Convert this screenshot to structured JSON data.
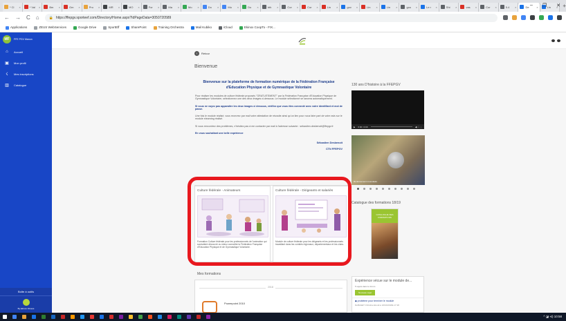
{
  "browser": {
    "tabs": [
      {
        "label": "* Cl",
        "color": "#e8a33d"
      },
      {
        "label": "* Val",
        "color": "#d93025"
      },
      {
        "label": "Bm",
        "color": "#d93025"
      },
      {
        "label": "Gm",
        "color": "#d93025"
      },
      {
        "label": "Pro",
        "color": "#e8a33d"
      },
      {
        "label": "MR",
        "color": "#3c4043"
      },
      {
        "label": "MO",
        "color": "#3c4043"
      },
      {
        "label": "For",
        "color": "#5f6368"
      },
      {
        "label": "Ma",
        "color": "#5f6368"
      },
      {
        "label": "Mo",
        "color": "#34a853"
      },
      {
        "label": "Do",
        "color": "#4285f4"
      },
      {
        "label": "Mo",
        "color": "#4285f4"
      },
      {
        "label": "Do",
        "color": "#34a853"
      },
      {
        "label": "bth",
        "color": "#5f6368"
      },
      {
        "label": "Cor",
        "color": "#5f6368"
      },
      {
        "label": "Cor",
        "color": "#d93025"
      },
      {
        "label": "Lin",
        "color": "#d93025"
      },
      {
        "label": "gov",
        "color": "#1a73e8"
      },
      {
        "label": "Lin",
        "color": "#d93025"
      },
      {
        "label": "Lin",
        "color": "#1a73e8"
      },
      {
        "label": "goo",
        "color": "#5f6368"
      },
      {
        "label": "Le r",
        "color": "#1a73e8"
      },
      {
        "label": "Shi",
        "color": "#5f6368"
      },
      {
        "label": "vas",
        "color": "#d93025"
      },
      {
        "label": "Cor",
        "color": "#5f6368"
      },
      {
        "label": "5.4",
        "color": "#5f6368"
      },
      {
        "label": "De",
        "color": "#1a73e8",
        "active": true
      },
      {
        "label": "Lin",
        "color": "#1a73e8"
      }
    ],
    "new_tab": "+",
    "window_controls": [
      "–",
      "❐",
      "✕"
    ],
    "back": "←",
    "forward": "→",
    "reload": "C",
    "home": "⌂",
    "url": "https://ffepgv.sporteef.com/Directory/Home.aspx?IdPageData=3050720589",
    "bookmarks": [
      {
        "label": "Applications",
        "color": "#4285f4"
      },
      {
        "label": "ZEUS WebServices",
        "color": "#9aa0a6"
      },
      {
        "label": "Google Drive",
        "color": "#34a853"
      },
      {
        "label": "SportEff",
        "color": "#9aa0a6"
      },
      {
        "label": "SharePoint",
        "color": "#1a73e8"
      },
      {
        "label": "Training Orchestra",
        "color": "#e8a33d"
      },
      {
        "label": "Mail Kubiko",
        "color": "#1a73e8"
      },
      {
        "label": "iCloud",
        "color": "#5f6368"
      },
      {
        "label": "Ekinox CoopTo - FIX...",
        "color": "#34a853"
      }
    ],
    "ext_colors": [
      "#5f6368",
      "#e8a33d",
      "#4285f4",
      "#3c4043",
      "#34a853",
      "#1a73e8",
      "#3c4043"
    ]
  },
  "sidebar": {
    "avatar_initials": "MF",
    "org_name": "FFE PGV Manon",
    "items": [
      {
        "icon": "⌂",
        "label": "Accueil"
      },
      {
        "icon": "▣",
        "label": "Mon profil"
      },
      {
        "icon": "☇",
        "label": "Mes inscriptions"
      },
      {
        "icon": "▥",
        "label": "Catalogue"
      }
    ],
    "help": "Boîte à outils",
    "logo_caption": "By Ekinox Fitness"
  },
  "main": {
    "back_label": "Retour",
    "title": "Bienvenue",
    "intro_heading": "Bienvenue sur la plateforme de formation numérique de la Fédération Française d'Education Physique et de Gymnastique Volontaire",
    "paragraphs": [
      {
        "text": "Pour réaliser les modules de culture fédérale proposés \"GRATUITEMENT\" par la Fédération Française d'Education Physique de Gymnastique Volontaire, sélectionnez une des deux images ci-dessous. Le module sélectionné se lancera automatiquement.",
        "bold": false
      },
      {
        "text": "Si vous ne voyez pas apparaître les deux images ci dessous, vérifiez que vous êtes connecté avec votre identifiant et mot de passe.",
        "bold": true
      },
      {
        "text": "Une fois le module réalisé, vous recevrez par mail votre attestation de réussite ainsi qu'un lien pour nous faire part de votre avis sur le module elearning réalisé.",
        "bold": false
      },
      {
        "text": "Si vous rencontrez des problèmes, n'hésitez pas à me contacter par mail à l'adresse suivante : sebastien.desbenoit@ffepgv.fr",
        "bold": false
      },
      {
        "text": "En vous souhaitant une belle expérience",
        "bold": true
      }
    ],
    "signature_name": "Sébastien Desbenoit",
    "signature_role": "CTN FFEPGV",
    "video_title": "130 ans D'histoire à la FFEPGV",
    "video_time": "0:00 / 0:00",
    "video_controls": "◀) ⛶ ⋮",
    "photo_caption": "Renforcement musculaire",
    "carousel_count": 10,
    "carousel_active": 0,
    "cards": [
      {
        "title": "Culture fédérale - Animateurs",
        "desc": "Formation Culture fédérale pour les professionnels de l'animation qui souhaitent découvrir ou mieux connaître la Fédération Française d'Education Physique et de Gymnastique Volontaire."
      },
      {
        "title": "Culture fédérale - Dirigeants et salariés",
        "desc": "Module de culture fédérale pour les dirigeants et les professionnels travaillant dans les comités régionaux, départementaux et les clubs."
      }
    ],
    "catalog_title": "Catalogue des formations 18/19",
    "catalog_cover_text": "CATALOGUE DES FORMATIONS",
    "my_trainings_title": "Mes formations",
    "year": "2018",
    "training_name": "Powerpoint 2010",
    "experience_title": "Expérience vécue sur le module de...",
    "experience_sub": "5 sujets dans le forum",
    "experience_btn": "Nouveau sujet",
    "experience_question": "◆ problème pour terminer le module",
    "experience_meta": "DeBAGET Christine ELLE le 22/10/2018à 17:18"
  },
  "taskbar": {
    "icon_colors": [
      "#fff",
      "#4285f4",
      "#e8a33d",
      "#1a73e8",
      "#2e7d32",
      "#1565c0",
      "#c62828",
      "#ff9800",
      "#2196f3",
      "#e53935",
      "#1a73e8",
      "#d32f2f",
      "#7b1fa2",
      "#fbc02d",
      "#43a047",
      "#f4511e",
      "#1e88e5",
      "#d81b60",
      "#00897b",
      "#5e35b1",
      "#c62828",
      "#8e24aa"
    ],
    "clock": "^ ◪ ⊲) 10:58"
  }
}
